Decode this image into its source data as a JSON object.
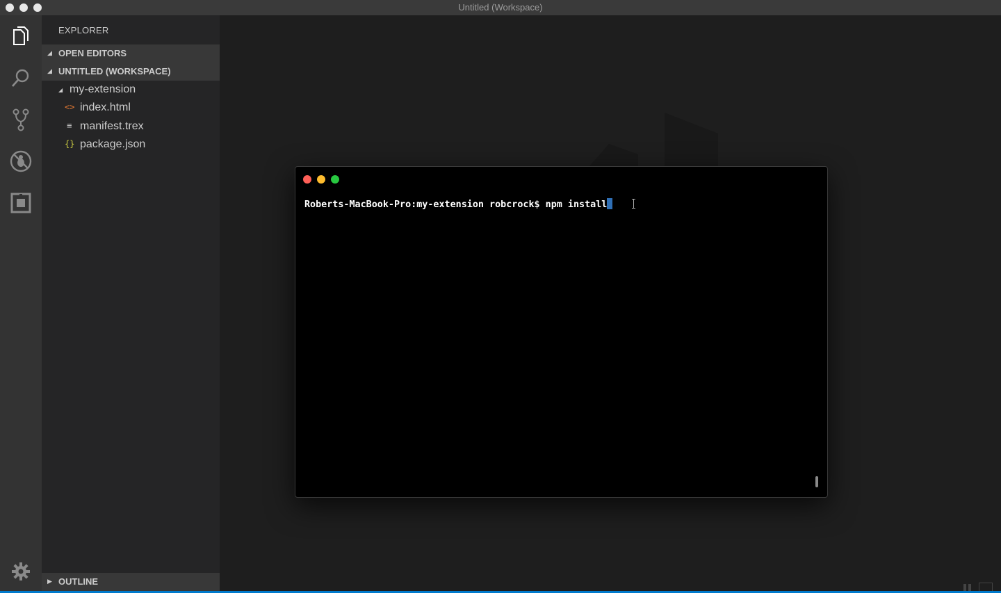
{
  "window": {
    "title": "Untitled (Workspace)"
  },
  "sidebar": {
    "title": "EXPLORER",
    "sections": {
      "open_editors": "OPEN EDITORS",
      "workspace": "UNTITLED (WORKSPACE)",
      "outline": "OUTLINE"
    },
    "tree": {
      "folder": "my-extension",
      "files": [
        {
          "name": "index.html",
          "icon": "html-file-icon",
          "icon_glyph": "<>",
          "color": "#e37933"
        },
        {
          "name": "manifest.trex",
          "icon": "text-file-icon",
          "icon_glyph": "≡",
          "color": "#cccccc"
        },
        {
          "name": "package.json",
          "icon": "json-file-icon",
          "icon_glyph": "{}",
          "color": "#cbcb41"
        }
      ]
    }
  },
  "activity_bar": [
    "explorer-icon",
    "search-icon",
    "source-control-icon",
    "debug-icon",
    "extensions-icon",
    "settings-gear-icon"
  ],
  "terminal": {
    "prompt": "Roberts-MacBook-Pro:my-extension robcrock$ ",
    "command": "npm install",
    "dots": {
      "close": "#fe5f57",
      "minimize": "#febc2e",
      "zoom": "#28c840"
    }
  },
  "colors": {
    "accent": "#007acc",
    "editor_bg": "#1e1e1e",
    "sidebar_bg": "#252526",
    "activity_bg": "#333333"
  }
}
